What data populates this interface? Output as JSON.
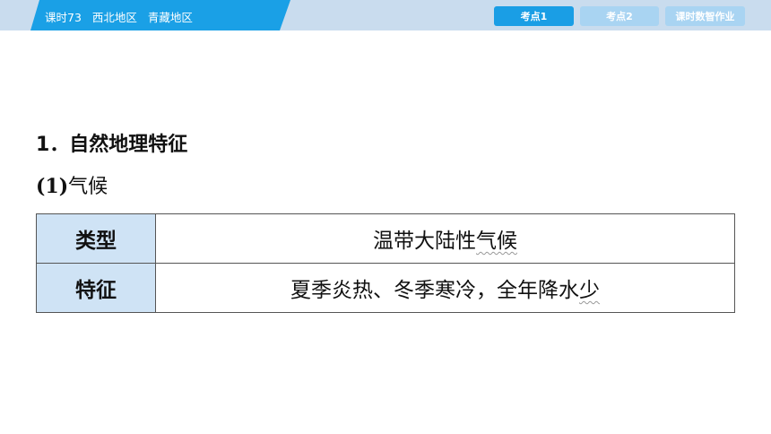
{
  "header": {
    "lesson": "课时73",
    "region1": "西北地区",
    "region2": "青藏地区"
  },
  "tabs": [
    {
      "label": "考点1",
      "active": true
    },
    {
      "label": "考点2",
      "active": false
    },
    {
      "label": "课时数智作业",
      "active": false
    }
  ],
  "content": {
    "heading": "1．自然地理特征",
    "sub_number": "(1)",
    "sub_title": "气候",
    "table": [
      {
        "label": "类型",
        "value_plain": "温带大陆性",
        "value_wavy": "气候",
        "value_tail": ""
      },
      {
        "label": "特征",
        "value_plain": "夏季炎热、冬季寒冷，全年降水",
        "value_wavy": "少",
        "value_tail": ""
      }
    ]
  },
  "colors": {
    "header_bg": "#c9dcee",
    "title_band": "#1aa0e6",
    "tab_active": "#1a9ee5",
    "tab_inactive": "#a9d4f2",
    "label_cell": "#cfe3f5"
  }
}
